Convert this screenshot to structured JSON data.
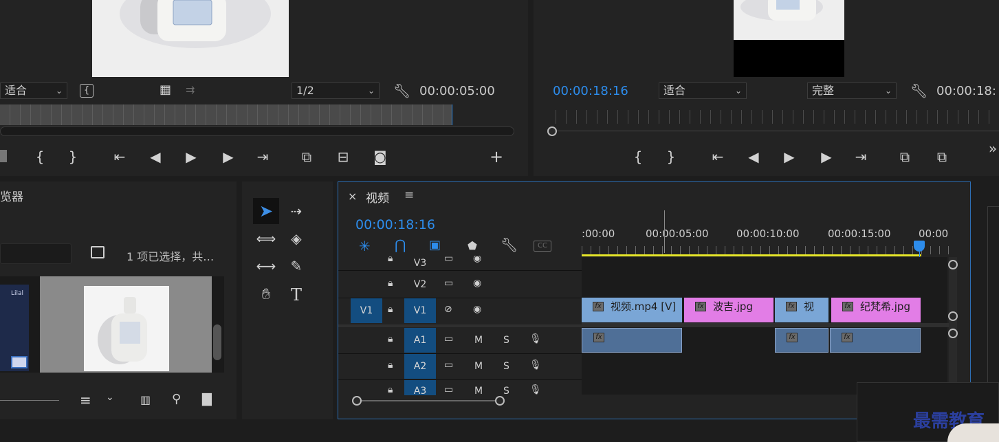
{
  "source_monitor": {
    "zoom_label": "适合",
    "resolution_label": "1/2",
    "timecode": "00:00:05:00"
  },
  "program_monitor": {
    "timecode_current": "00:00:18:16",
    "zoom_label": "适合",
    "quality_label": "完整",
    "timecode_duration": "00:00:18:"
  },
  "project_panel": {
    "title_fragment": "览器",
    "selection_status": "1 项已选择，共…",
    "thumb_label": "Lilal"
  },
  "timeline": {
    "sequence_name": "视频",
    "close_symbol": "×",
    "menu_symbol": "≡",
    "playhead_timecode": "00:00:18:16",
    "ruler_labels": [
      ":00:00",
      "00:00:05:00",
      "00:00:10:00",
      "00:00:15:00",
      "00:00"
    ],
    "tracks": {
      "V3": "V3",
      "V2": "V2",
      "V1_source": "V1",
      "V1": "V1",
      "A1": "A1",
      "A2": "A2",
      "A3": "A3",
      "mute": "M",
      "solo": "S"
    },
    "clips": {
      "clip1": "视频.mp4 [V]",
      "clip2": "波吉.jpg",
      "clip3": "视",
      "clip4": "纪梵希.jpg",
      "fx_badge": "fx"
    },
    "cc_badge": "CC"
  },
  "tools": {
    "type_tool": "T"
  },
  "watermark": {
    "text": "最需教育"
  },
  "colors": {
    "accent_blue": "#2d8ceb",
    "video_clip": "#7aa6d6",
    "image_clip": "#e27de6",
    "audio_clip": "#4f6f97",
    "work_area": "#e6e629"
  }
}
